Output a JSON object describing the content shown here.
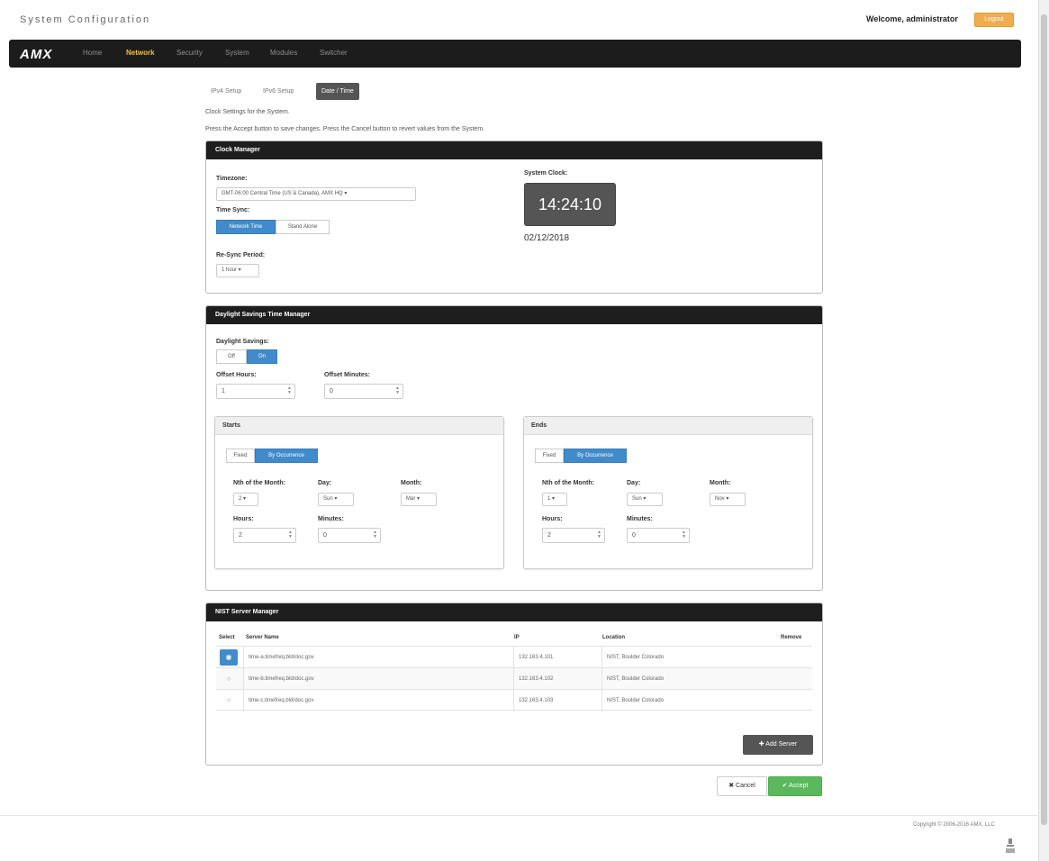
{
  "app": {
    "title": "System Configuration",
    "welcome": "Welcome, administrator",
    "logout_label": "Logout",
    "logo": "AMX"
  },
  "nav": [
    {
      "label": "Home",
      "active": false
    },
    {
      "label": "Network",
      "active": true
    },
    {
      "label": "Security",
      "active": false
    },
    {
      "label": "System",
      "active": false
    },
    {
      "label": "Modules",
      "active": false
    },
    {
      "label": "Switcher",
      "active": false
    }
  ],
  "subtabs": [
    {
      "label": "IPv4 Setup",
      "active": false
    },
    {
      "label": "IPv6 Setup",
      "active": false
    },
    {
      "label": "Date / Time",
      "active": true
    }
  ],
  "intro": {
    "line1": "Clock Settings for the System.",
    "line2": "Press the Accept button to save changes. Press the Cancel button to revert values from the System."
  },
  "clock_manager": {
    "title": "Clock Manager",
    "timezone_label": "Timezone:",
    "timezone_value": "GMT-06:00 Central Time (US & Canada), AMX HQ",
    "time_sync_label": "Time Sync:",
    "time_sync_options": [
      "Network Time",
      "Stand Alone"
    ],
    "resync_label": "Re-Sync Period:",
    "resync_value": "1 hour",
    "system_clock_label": "System Clock:",
    "time": "14:24:10",
    "date": "02/12/2018"
  },
  "dst_manager": {
    "title": "Daylight Savings Time Manager",
    "dst_label": "Daylight Savings:",
    "dst_off": "Off",
    "dst_on": "On",
    "offset_hours_label": "Offset Hours:",
    "offset_hours": "1",
    "offset_minutes_label": "Offset Minutes:",
    "offset_minutes": "0",
    "starts": {
      "title": "Starts",
      "mode_fixed": "Fixed",
      "mode_occurrence": "By Occurrence",
      "nth_label": "Nth of the Month:",
      "nth": "2",
      "day_label": "Day:",
      "day": "Sun",
      "month_label": "Month:",
      "month": "Mar",
      "hours_label": "Hours:",
      "hours": "2",
      "minutes_label": "Minutes:",
      "minutes": "0"
    },
    "ends": {
      "title": "Ends",
      "mode_fixed": "Fixed",
      "mode_occurrence": "By Occurrence",
      "nth_label": "Nth of the Month:",
      "nth": "1",
      "day_label": "Day:",
      "day": "Sun",
      "month_label": "Month:",
      "month": "Nov",
      "hours_label": "Hours:",
      "hours": "2",
      "minutes_label": "Minutes:",
      "minutes": "0"
    }
  },
  "nist": {
    "title": "NIST Server Manager",
    "columns": [
      "Select",
      "Server Name",
      "IP",
      "Location",
      "Remove"
    ],
    "rows": [
      {
        "name": "time-a.timefreq.bldrdoc.gov",
        "ip": "132.163.4.101",
        "location": "NIST, Boulder Colorado",
        "selected": true
      },
      {
        "name": "time-b.timefreq.bldrdoc.gov",
        "ip": "132.163.4.102",
        "location": "NIST, Boulder Colorado",
        "selected": false
      },
      {
        "name": "time-c.timefreq.bldrdoc.gov",
        "ip": "132.163.4.103",
        "location": "NIST, Boulder Colorado",
        "selected": false
      }
    ],
    "add_server_label": "Add Server"
  },
  "actions": {
    "cancel_label": "Cancel",
    "accept_label": "Accept"
  },
  "footer": {
    "copyright": "Copyright © 2006-2016 AMX, LLC"
  },
  "colors": {
    "accent": "#428bca",
    "accept": "#5cb85c",
    "logout": "#f0ad4e",
    "header": "#1e1e1e"
  }
}
